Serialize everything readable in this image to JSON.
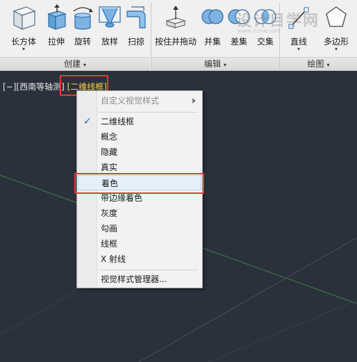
{
  "ribbon": {
    "panels": [
      {
        "title": "创建",
        "tools": [
          {
            "label": "长方体",
            "icon": "box-icon",
            "has_dropdown": true
          },
          {
            "label": "拉伸",
            "icon": "extrude-icon"
          },
          {
            "label": "旋转",
            "icon": "revolve-icon"
          },
          {
            "label": "放样",
            "icon": "loft-icon"
          },
          {
            "label": "扫掠",
            "icon": "sweep-icon"
          }
        ]
      },
      {
        "title": "编辑",
        "tools": [
          {
            "label": "按住并拖动",
            "icon": "presspull-icon"
          },
          {
            "label": "并集",
            "icon": "union-icon"
          },
          {
            "label": "差集",
            "icon": "subtract-icon"
          },
          {
            "label": "交集",
            "icon": "intersect-icon"
          }
        ]
      },
      {
        "title": "绘图",
        "tools": [
          {
            "label": "直线",
            "icon": "line-icon",
            "has_dropdown": true
          },
          {
            "label": "多边形",
            "icon": "polygon-icon",
            "has_dropdown": true
          }
        ]
      }
    ],
    "dropdown_glyph": "▾"
  },
  "viewport": {
    "control_label": "[−]",
    "view_label": "[西南等轴测]",
    "visual_style_label": "[二维线框]",
    "background": "#2b313c",
    "grid_line_color": "#3f7f3f"
  },
  "context_menu": {
    "items": [
      {
        "label": "自定义视觉样式",
        "disabled": true,
        "submenu": true
      },
      {
        "label": "二维线框",
        "checked": true
      },
      {
        "label": "概念"
      },
      {
        "label": "隐藏"
      },
      {
        "label": "真实"
      },
      {
        "label": "着色",
        "highlighted": true
      },
      {
        "label": "带边缘着色"
      },
      {
        "label": "灰度"
      },
      {
        "label": "勾画"
      },
      {
        "label": "线框"
      },
      {
        "label": "X 射线"
      },
      {
        "label": "视觉样式管理器..."
      }
    ],
    "check_glyph": "✓"
  },
  "watermark": {
    "text": "设计目学网",
    "sub": "www.rjzxw.com"
  },
  "colors": {
    "highlight_box": "#e53935",
    "active_style_text": "#ffd24a",
    "menu_hot": "#e5eff9"
  }
}
